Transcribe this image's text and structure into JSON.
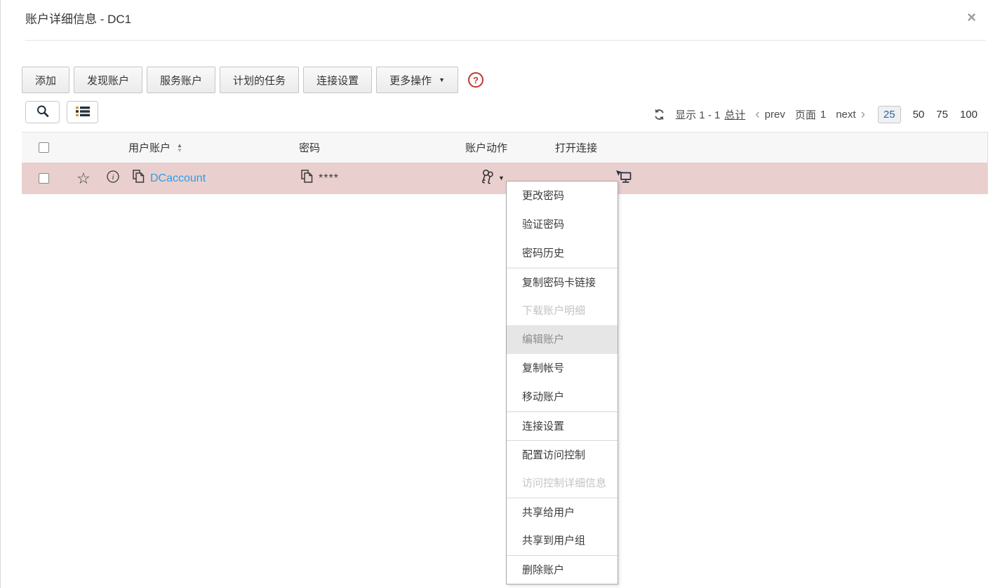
{
  "dialog": {
    "title": "账户详细信息 - DC1"
  },
  "icons": {
    "close": "×",
    "caret_down": "▼",
    "help": "?",
    "star": "☆",
    "sort_up": "▲",
    "sort_down": "▼",
    "chevron_left": "‹",
    "chevron_right": "›"
  },
  "toolbar": {
    "buttons": [
      "添加",
      "发现账户",
      "服务账户",
      "计划的任务",
      "连接设置"
    ],
    "more_label": "更多操作"
  },
  "pagination": {
    "showing": "显示 1 - 1",
    "total_link": "总计",
    "prev_label": "prev",
    "page_label": "页面",
    "page_number": "1",
    "next_label": "next",
    "page_sizes": [
      "25",
      "50",
      "75",
      "100"
    ],
    "selected_page_size": "25"
  },
  "table": {
    "headers": {
      "account": "用户账户",
      "password": "密码",
      "actions": "账户动作",
      "connection": "打开连接"
    },
    "row": {
      "account_name": "DCaccount",
      "password_mask": "****"
    }
  },
  "menu": {
    "items": [
      {
        "label": "更改密码",
        "state": "normal"
      },
      {
        "label": "验证密码",
        "state": "normal"
      },
      {
        "label": "密码历史",
        "state": "normal"
      },
      {
        "label": "复制密码卡链接",
        "state": "normal"
      },
      {
        "label": "下载账户明细",
        "state": "disabled"
      },
      {
        "label": "编辑账户",
        "state": "hovered"
      },
      {
        "label": "复制帐号",
        "state": "normal"
      },
      {
        "label": "移动账户",
        "state": "normal"
      },
      {
        "label": "连接设置",
        "state": "normal"
      },
      {
        "label": "配置访问控制",
        "state": "normal"
      },
      {
        "label": "访问控制详细信息",
        "state": "disabled"
      },
      {
        "label": "共享给用户",
        "state": "normal"
      },
      {
        "label": "共享到用户组",
        "state": "normal"
      },
      {
        "label": "删除账户",
        "state": "normal"
      }
    ]
  },
  "colors": {
    "link_blue": "#2d9fe0",
    "row_highlight_pink": "#eacfcf",
    "selected_size_blue": "#31618e",
    "help_red": "#c0392b",
    "header_gray": "#f7f7f7"
  }
}
